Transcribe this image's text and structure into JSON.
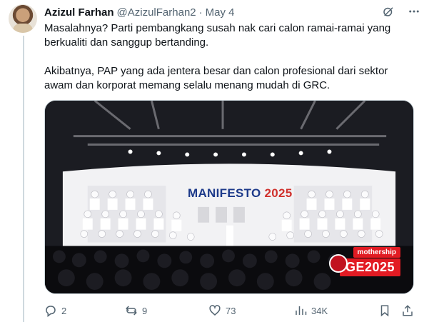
{
  "tweet": {
    "author_name": "Azizul Farhan",
    "author_handle": "@AzizulFarhan2",
    "separator": "·",
    "date": "May 4",
    "paragraphs": [
      "Masalahnya? Parti pembangkang susah nak cari calon ramai-ramai yang berkualiti dan sanggup bertanding.",
      "Akibatnya, PAP yang ada jentera besar dan calon profesional dari sektor awam dan korporat memang selalu menang mudah di GRC."
    ]
  },
  "media": {
    "banner_title": "MANIFESTO",
    "banner_year": "2025",
    "watermark_brand": "mothership",
    "watermark_tag": "GE2025"
  },
  "actions": {
    "reply_count": "2",
    "retweet_count": "9",
    "like_count": "73",
    "views_count": "34K"
  },
  "icons": {
    "header": [
      "grok-icon",
      "more-icon"
    ],
    "actions": [
      "reply-icon",
      "retweet-icon",
      "like-icon",
      "views-icon",
      "bookmark-icon",
      "share-icon"
    ]
  },
  "colors": {
    "text_primary": "#0f1419",
    "text_secondary": "#536471",
    "border": "#cfd9de",
    "brand_red": "#e21b23",
    "manifesto_blue": "#1d3a8a"
  }
}
